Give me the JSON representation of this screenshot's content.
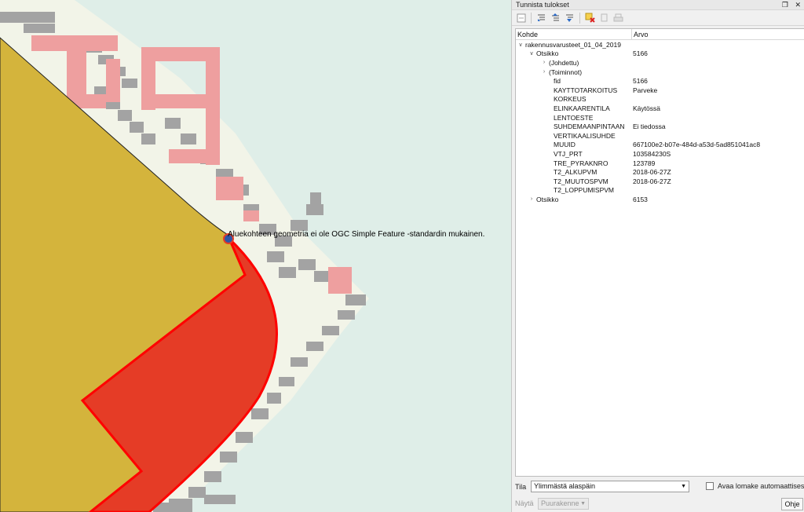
{
  "map": {
    "tooltip": "Aluekohteen geometria ei ole OGC Simple Feature -standardin mukainen.",
    "colors": {
      "water": "#dfeee8",
      "land": "#f2f4e8",
      "building": "#a3a3a3",
      "label": "#ee9f9f",
      "polygon_yellow": "#d4b43c",
      "polygon_red": "#e53c26",
      "outline_red": "#ff0000",
      "vertex": "#2d55a6"
    }
  },
  "panel": {
    "title": "Tunnista tulokset",
    "title_icons": [
      "restore-icon",
      "close-icon"
    ],
    "toolbar_icons": [
      "expand-tree-icon",
      "collapse-tree-icon",
      "expand-all-icon",
      "collapse-all-icon",
      "clear-results-icon",
      "copy-feature-icon",
      "print-icon"
    ],
    "columns": {
      "feature": "Kohde",
      "value": "Arvo"
    },
    "layer_name": "rakennusvarusteet_01_04_2019",
    "features": [
      {
        "name": "Otsikko",
        "value": "5166",
        "groups": [
          "(Johdettu)",
          "(Toiminnot)"
        ],
        "attributes": [
          {
            "key": "fid",
            "value": "5166"
          },
          {
            "key": "KAYTTOTARKOITUS",
            "value": "Parveke"
          },
          {
            "key": "KORKEUS",
            "value": ""
          },
          {
            "key": "ELINKAARENTILA",
            "value": "Käytössä"
          },
          {
            "key": "LENTOESTE",
            "value": ""
          },
          {
            "key": "SUHDEMAANPINTAAN",
            "value": "Ei tiedossa"
          },
          {
            "key": "VERTIKAALISUHDE",
            "value": ""
          },
          {
            "key": "MUUID",
            "value": "667100e2-b07e-484d-a53d-5ad851041ac8"
          },
          {
            "key": "VTJ_PRT",
            "value": "103584230S"
          },
          {
            "key": "TRE_PYRAKNRO",
            "value": "123789"
          },
          {
            "key": "T2_ALKUPVM",
            "value": "2018-06-27Z"
          },
          {
            "key": "T2_MUUTOSPVM",
            "value": "2018-06-27Z"
          },
          {
            "key": "T2_LOPPUMISPVM",
            "value": ""
          }
        ]
      },
      {
        "name": "Otsikko",
        "value": "6153"
      }
    ],
    "mode": {
      "label": "Tila",
      "value": "Ylimmästä alaspäin"
    },
    "auto_open": {
      "label": "Avaa lomake automaattisesti",
      "checked": false
    },
    "view": {
      "label": "Näytä",
      "value": "Puurakenne"
    },
    "help_label": "Ohje"
  }
}
